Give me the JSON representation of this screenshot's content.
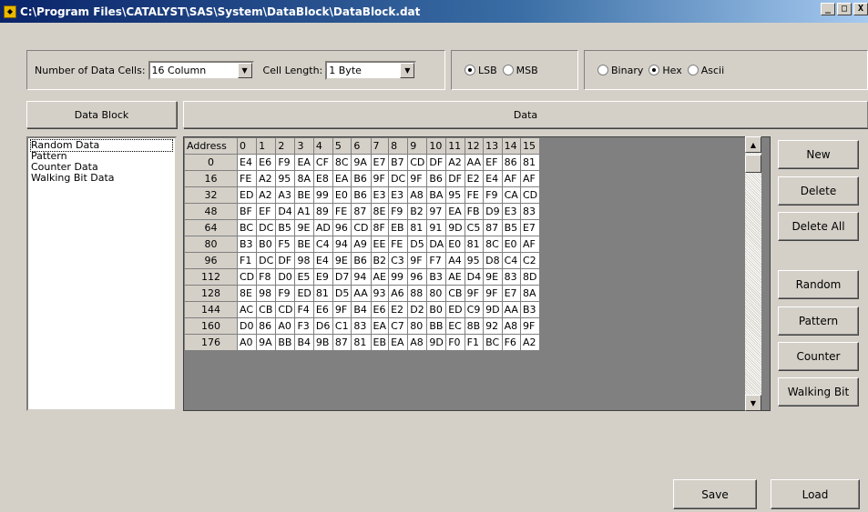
{
  "window": {
    "title": "C:\\Program Files\\CATALYST\\SAS\\System\\DataBlock\\DataBlock.dat",
    "min_glyph": "_",
    "max_glyph": "□",
    "close_glyph": "X"
  },
  "settings": {
    "cells_label": "Number of Data Cells:",
    "cells_value": "16 Column",
    "length_label": "Cell Length:",
    "length_value": "1 Byte",
    "order_options": [
      "LSB",
      "MSB"
    ],
    "order_selected": "LSB",
    "format_options": [
      "Binary",
      "Hex",
      "Ascii"
    ],
    "format_selected": "Hex"
  },
  "panels": {
    "block_header": "Data Block",
    "data_header": "Data"
  },
  "data_blocks": [
    "Random Data",
    "Pattern",
    "Counter Data",
    "Walking Bit Data"
  ],
  "selected_block": "Random Data",
  "grid": {
    "address_header": "Address",
    "columns": [
      "0",
      "1",
      "2",
      "3",
      "4",
      "5",
      "6",
      "7",
      "8",
      "9",
      "10",
      "11",
      "12",
      "13",
      "14",
      "15"
    ],
    "rows": [
      {
        "address": "0",
        "cells": [
          "E4",
          "E6",
          "F9",
          "EA",
          "CF",
          "8C",
          "9A",
          "E7",
          "B7",
          "CD",
          "DF",
          "A2",
          "AA",
          "EF",
          "86",
          "81"
        ]
      },
      {
        "address": "16",
        "cells": [
          "FE",
          "A2",
          "95",
          "8A",
          "E8",
          "EA",
          "B6",
          "9F",
          "DC",
          "9F",
          "B6",
          "DF",
          "E2",
          "E4",
          "AF",
          "AF"
        ]
      },
      {
        "address": "32",
        "cells": [
          "ED",
          "A2",
          "A3",
          "BE",
          "99",
          "E0",
          "B6",
          "E3",
          "E3",
          "A8",
          "BA",
          "95",
          "FE",
          "F9",
          "CA",
          "CD"
        ]
      },
      {
        "address": "48",
        "cells": [
          "BF",
          "EF",
          "D4",
          "A1",
          "89",
          "FE",
          "87",
          "8E",
          "F9",
          "B2",
          "97",
          "EA",
          "FB",
          "D9",
          "E3",
          "83"
        ]
      },
      {
        "address": "64",
        "cells": [
          "BC",
          "DC",
          "B5",
          "9E",
          "AD",
          "96",
          "CD",
          "8F",
          "EB",
          "81",
          "91",
          "9D",
          "C5",
          "87",
          "B5",
          "E7"
        ]
      },
      {
        "address": "80",
        "cells": [
          "B3",
          "B0",
          "F5",
          "BE",
          "C4",
          "94",
          "A9",
          "EE",
          "FE",
          "D5",
          "DA",
          "E0",
          "81",
          "8C",
          "E0",
          "AF"
        ]
      },
      {
        "address": "96",
        "cells": [
          "F1",
          "DC",
          "DF",
          "98",
          "E4",
          "9E",
          "B6",
          "B2",
          "C3",
          "9F",
          "F7",
          "A4",
          "95",
          "D8",
          "C4",
          "C2"
        ]
      },
      {
        "address": "112",
        "cells": [
          "CD",
          "F8",
          "D0",
          "E5",
          "E9",
          "D7",
          "94",
          "AE",
          "99",
          "96",
          "B3",
          "AE",
          "D4",
          "9E",
          "83",
          "8D"
        ]
      },
      {
        "address": "128",
        "cells": [
          "8E",
          "98",
          "F9",
          "ED",
          "81",
          "D5",
          "AA",
          "93",
          "A6",
          "88",
          "80",
          "CB",
          "9F",
          "9F",
          "E7",
          "8A"
        ]
      },
      {
        "address": "144",
        "cells": [
          "AC",
          "CB",
          "CD",
          "F4",
          "E6",
          "9F",
          "B4",
          "E6",
          "E2",
          "D2",
          "B0",
          "ED",
          "C9",
          "9D",
          "AA",
          "B3"
        ]
      },
      {
        "address": "160",
        "cells": [
          "D0",
          "86",
          "A0",
          "F3",
          "D6",
          "C1",
          "83",
          "EA",
          "C7",
          "80",
          "BB",
          "EC",
          "8B",
          "92",
          "A8",
          "9F"
        ]
      },
      {
        "address": "176",
        "cells": [
          "A0",
          "9A",
          "BB",
          "B4",
          "9B",
          "87",
          "81",
          "EB",
          "EA",
          "A8",
          "9D",
          "F0",
          "F1",
          "BC",
          "F6",
          "A2"
        ]
      }
    ]
  },
  "buttons": {
    "new": "New",
    "delete": "Delete",
    "delete_all": "Delete All",
    "random": "Random",
    "pattern": "Pattern",
    "counter": "Counter",
    "walking_bit": "Walking Bit",
    "save": "Save",
    "load": "Load"
  }
}
